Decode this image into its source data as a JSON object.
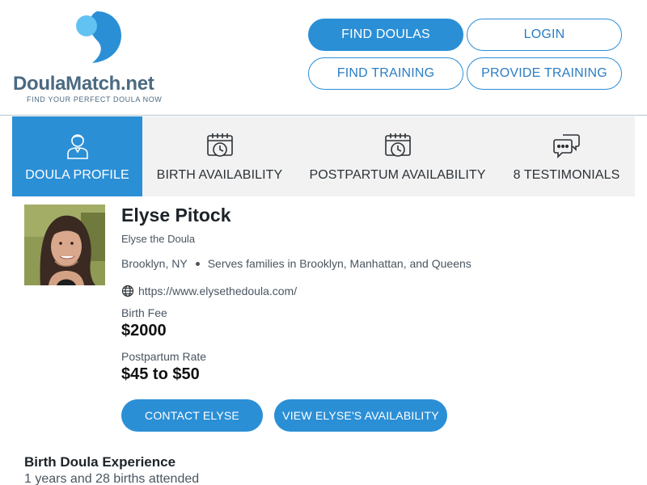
{
  "logo": {
    "name_part1": "Doula",
    "name_part2": "Match.net",
    "tagline": "FIND YOUR PERFECT DOULA NOW",
    "colors": {
      "dark_blue": "#2b8fd6",
      "light_blue": "#62c2f2",
      "text": "#4b6a82"
    }
  },
  "nav": {
    "find_doulas": "FIND DOULAS",
    "login": "LOGIN",
    "find_training": "FIND TRAINING",
    "provide_training": "PROVIDE TRAINING"
  },
  "tabs": [
    {
      "label": "DOULA PROFILE",
      "icon": "person-icon",
      "active": true
    },
    {
      "label": "BIRTH AVAILABILITY",
      "icon": "calendar-clock-icon",
      "active": false
    },
    {
      "label": "POSTPARTUM AVAILABILITY",
      "icon": "calendar-clock-icon",
      "active": false
    },
    {
      "label": "8 TESTIMONIALS",
      "icon": "chat-bubbles-icon",
      "active": false
    }
  ],
  "profile": {
    "name": "Elyse Pitock",
    "nickname": "Elyse the Doula",
    "location": "Brooklyn, NY",
    "service_area": "Serves families in Brooklyn, Manhattan, and Queens",
    "website": "https://www.elysethedoula.com/",
    "birth_fee_label": "Birth Fee",
    "birth_fee": "$2000",
    "postpartum_label": "Postpartum Rate",
    "postpartum_rate": "$45 to $50",
    "contact_button": "CONTACT ELYSE",
    "availability_button": "VIEW ELYSE'S AVAILABILITY"
  },
  "experience": {
    "title": "Birth Doula Experience",
    "value": "1 years and 28 births attended"
  },
  "accent_color": "#2b8fd6"
}
